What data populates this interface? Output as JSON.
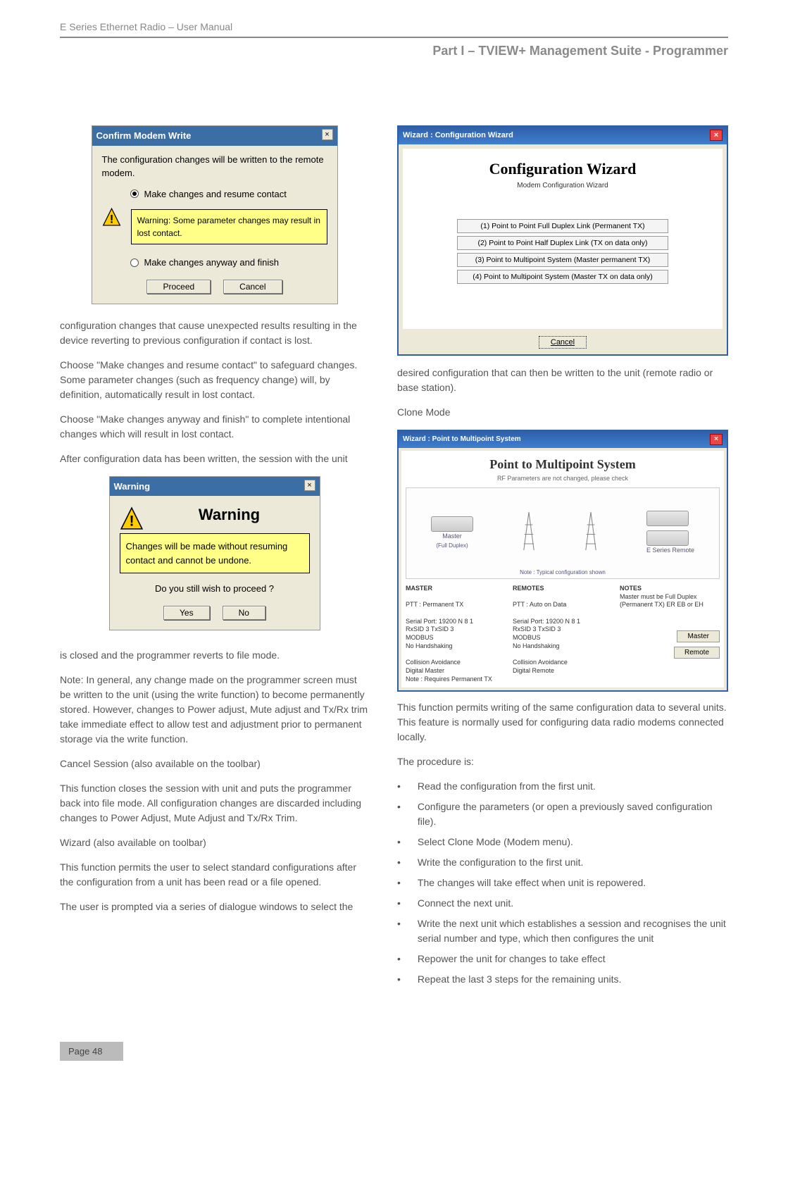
{
  "header": {
    "doc_title": "E Series Ethernet Radio – User Manual",
    "section_title": "Part I – TVIEW+ Management Suite - Programmer"
  },
  "left": {
    "confirm": {
      "title": "Confirm Modem Write",
      "line1": "The configuration changes will be written to the remote modem.",
      "opt1": "Make changes and resume contact",
      "warn": "Warning: Some parameter changes may result in lost contact.",
      "opt2": "Make changes anyway and finish",
      "proceed": "Proceed",
      "cancel": "Cancel"
    },
    "p1": "configuration changes that cause unexpected results resulting in the device reverting to previous configuration if contact is lost.",
    "p2": "Choose \"Make changes and resume contact\" to safeguard changes. Some parameter changes (such as frequency change) will, by definition, automatically result in lost contact.",
    "p3": "Choose \"Make changes anyway and finish\" to complete intentional changes which will result in lost contact.",
    "p4": "After configuration data has been written, the session with the unit",
    "warning": {
      "title": "Warning",
      "big": "Warning",
      "msg": "Changes will be made without resuming contact and cannot be undone.",
      "q": "Do you still wish to proceed ?",
      "yes": "Yes",
      "no": "No"
    },
    "p5": "is closed and the programmer reverts to file mode.",
    "p6": "Note: In general, any change made on the programmer screen must be written to the unit (using the write function) to become permanently stored. However, changes to Power adjust, Mute adjust and Tx/Rx trim take immediate effect to allow test and adjustment prior to permanent storage via the write function.",
    "h1": "Cancel Session (also available on the toolbar)",
    "p7": "This function closes the session with unit and puts the programmer back into file mode. All configuration changes are discarded including changes to Power Adjust, Mute Adjust and Tx/Rx Trim.",
    "h2": "Wizard (also available on toolbar)",
    "p8": "This function permits the user to select standard configurations after the configuration from a unit has been read or a file opened.",
    "p9": "The user is prompted via a series of dialogue windows to select the"
  },
  "right": {
    "wizard": {
      "title": "Wizard : Configuration Wizard",
      "big": "Configuration Wizard",
      "sub": "Modem Configuration Wizard",
      "b1": "(1) Point to Point Full Duplex Link (Permanent TX)",
      "b2": "(2) Point to Point Half Duplex Link (TX on data only)",
      "b3": "(3) Point to Multipoint System (Master permanent TX)",
      "b4": "(4) Point to Multipoint System (Master TX on data only)",
      "cancel": "Cancel"
    },
    "p1": "desired configuration that can then be written to the unit (remote radio or base station).",
    "h1": "Clone Mode",
    "ptmp": {
      "titlebar": "Wizard : Point to Multipoint System",
      "big": "Point to Multipoint System",
      "sub": "RF Parameters are not changed, please check",
      "note": "Note : Typical configuration shown",
      "col1_h": "MASTER",
      "col1_1": "PTT : Permanent TX",
      "col1_2": "Serial Port: 19200 N 8 1",
      "col1_3": "RxSID 3   TxSID 3",
      "col1_4": "MODBUS",
      "col1_5": "No Handshaking",
      "col1_6": "Collision Avoidance",
      "col1_7": "Digital Master",
      "col1_8": "Note : Requires Permanent TX",
      "col2_h": "REMOTES",
      "col2_1": "PTT : Auto on Data",
      "col2_2": "Serial Port: 19200 N 8 1",
      "col2_3": "RxSID 3   TxSID 3",
      "col2_4": "MODBUS",
      "col2_5": "No Handshaking",
      "col2_6": "Collision Avoidance",
      "col2_7": "Digital Remote",
      "col3_h": "NOTES",
      "col3_1": "Master must be Full Duplex (Permanent TX) ER EB or EH",
      "btn_master": "Master",
      "btn_remote": "Remote",
      "lab_master": "Master",
      "lab_fd": "(Full Duplex)",
      "lab_remote": "E Series Remote"
    },
    "p2": "This function permits writing of the same configuration data to several units. This feature is normally used for configuring data radio modems connected locally.",
    "p3": "The procedure is:",
    "bul": [
      "Read the configuration from the first unit.",
      "Configure the parameters (or open a previously saved configuration file).",
      "Select Clone Mode (Modem menu).",
      "Write the configuration to the first unit.",
      "The changes will take effect when unit is repowered.",
      "Connect the next unit.",
      "Write the next unit which establishes a session and recognises the unit serial number and type, which then configures the unit",
      "Repower the unit for changes to take effect",
      "Repeat the last 3 steps for the remaining units."
    ]
  },
  "footer": {
    "page": "Page 48"
  }
}
